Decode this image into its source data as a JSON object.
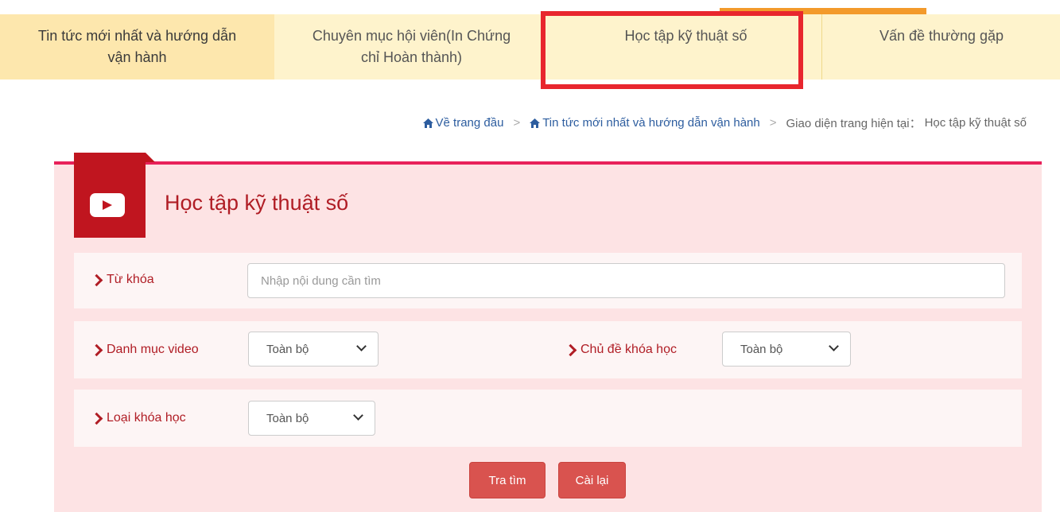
{
  "nav": {
    "tabs": [
      {
        "label_line1": "Tin tức mới nhất và hướng dẫn",
        "label_line2": "vận hành"
      },
      {
        "label_line1": "Chuyên mục hội viên(In Chứng",
        "label_line2": "chỉ Hoàn thành)"
      },
      {
        "label_line1": "Học tập kỹ thuật số",
        "label_line2": ""
      },
      {
        "label_line1": "Vấn đề thường gặp",
        "label_line2": ""
      }
    ]
  },
  "breadcrumb": {
    "home": "Về trang đầu",
    "parent": "Tin tức mới nhất và hướng dẫn vận hành",
    "current_prefix": "Giao diện trang hiện tại：",
    "current": "Học tập kỹ thuật số"
  },
  "panel": {
    "title": "Học tập kỹ thuật số",
    "keyword_label": "Từ khóa",
    "keyword_placeholder": "Nhập nội dung cần tìm",
    "keyword_value": "",
    "video_category_label": "Danh mục video",
    "video_category_value": "Toàn bộ",
    "course_topic_label": "Chủ đề khóa học",
    "course_topic_value": "Toàn bộ",
    "course_type_label": "Loại khóa học",
    "course_type_value": "Toàn bộ",
    "search_button": "Tra tìm",
    "reset_button": "Cài lại"
  },
  "colors": {
    "accent": "#b01d25",
    "nav_bg": "#fef3cc",
    "highlight": "#e8262e",
    "button": "#d9534f"
  }
}
